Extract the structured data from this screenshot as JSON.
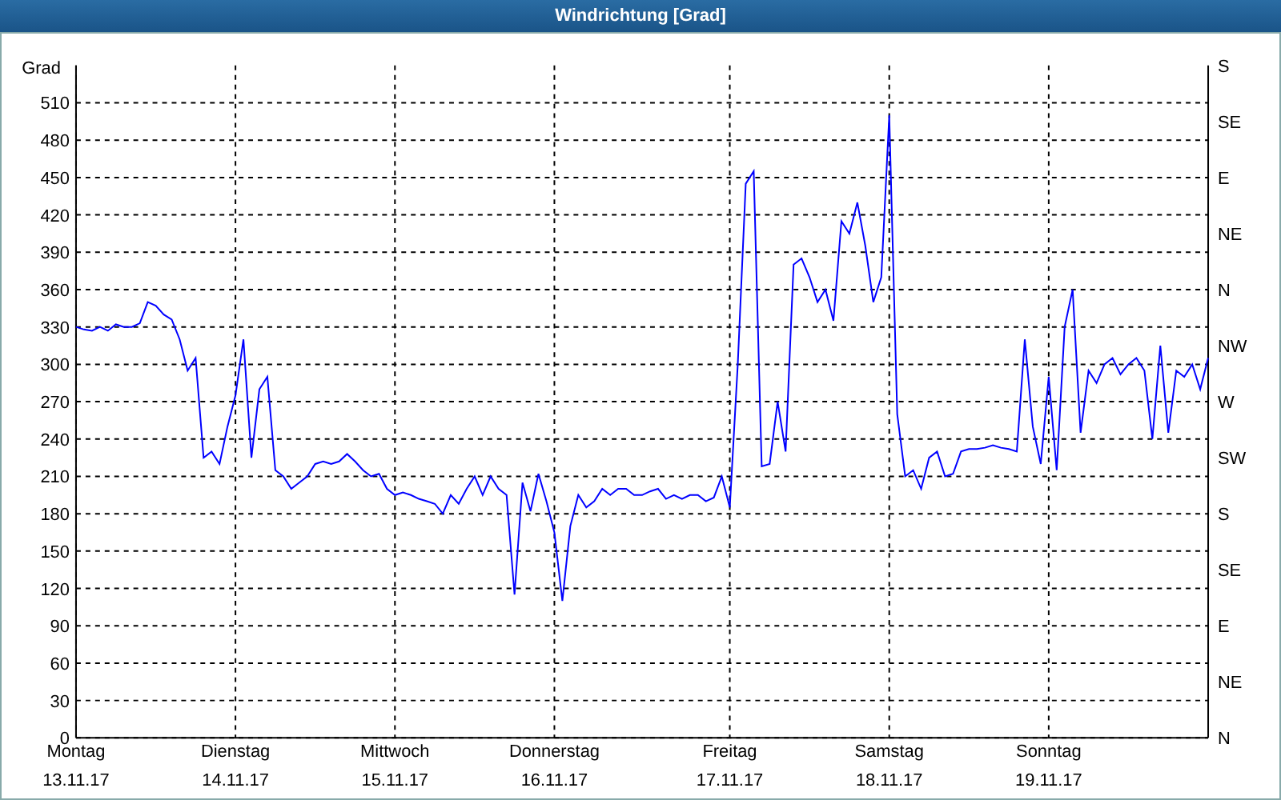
{
  "window": {
    "title": "Windrichtung [Grad]"
  },
  "chart": {
    "compass_labels": [
      "S",
      "SE",
      "E",
      "NE",
      "N",
      "NW",
      "W",
      "SW",
      "S",
      "SE",
      "E",
      "NE",
      "N"
    ],
    "dates": [
      "13.11.17",
      "14.11.17",
      "15.11.17",
      "16.11.17",
      "17.11.17",
      "18.11.17",
      "19.11.17"
    ],
    "chart_data": {
      "type": "line",
      "grid": true,
      "ylabel": "Grad",
      "ylim": [
        0,
        540
      ],
      "yticks": [
        0,
        30,
        60,
        90,
        120,
        150,
        180,
        210,
        240,
        270,
        300,
        330,
        360,
        390,
        420,
        450,
        480,
        510
      ],
      "categories": [
        "Montag",
        null,
        null,
        null,
        null,
        null,
        null,
        null,
        null,
        null,
        null,
        null,
        null,
        null,
        null,
        null,
        null,
        null,
        null,
        null,
        "Dienstag",
        null,
        null,
        null,
        null,
        null,
        null,
        null,
        null,
        null,
        null,
        null,
        null,
        null,
        null,
        null,
        null,
        null,
        null,
        null,
        "Mittwoch",
        null,
        null,
        null,
        null,
        null,
        null,
        null,
        null,
        null,
        null,
        null,
        null,
        null,
        null,
        null,
        null,
        null,
        null,
        null,
        "Donnerstag",
        null,
        null,
        null,
        null,
        null,
        null,
        null,
        null,
        null,
        null,
        null,
        null,
        null,
        null,
        null,
        null,
        null,
        null,
        null,
        null,
        null,
        "Freitag",
        null,
        null,
        null,
        null,
        null,
        null,
        null,
        null,
        null,
        null,
        null,
        null,
        null,
        null,
        null,
        null,
        null,
        null,
        null,
        "Samstag",
        null,
        null,
        null,
        null,
        null,
        null,
        null,
        null,
        null,
        null,
        null,
        null,
        null,
        null,
        null,
        null,
        null,
        null,
        null,
        "Sonntag",
        null,
        null,
        null,
        null,
        null,
        null,
        null,
        null,
        null,
        null,
        null,
        null,
        null,
        null,
        null,
        null,
        null,
        null,
        null,
        null
      ],
      "series": [
        {
          "color": "#0000ff",
          "values": [
            330,
            328,
            327,
            330,
            327,
            332,
            330,
            330,
            333,
            350,
            347,
            340,
            336,
            320,
            295,
            305,
            225,
            230,
            220,
            250,
            275,
            320,
            225,
            280,
            290,
            215,
            210,
            200,
            205,
            210,
            220,
            222,
            220,
            222,
            228,
            222,
            215,
            210,
            212,
            200,
            195,
            197,
            195,
            192,
            190,
            188,
            180,
            195,
            188,
            200,
            210,
            195,
            210,
            200,
            195,
            115,
            205,
            182,
            212,
            190,
            165,
            110,
            170,
            195,
            185,
            190,
            200,
            195,
            200,
            200,
            195,
            195,
            198,
            200,
            192,
            195,
            192,
            195,
            195,
            190,
            193,
            210,
            185,
            300,
            445,
            455,
            218,
            220,
            270,
            230,
            380,
            385,
            370,
            350,
            360,
            335,
            415,
            405,
            430,
            395,
            350,
            370,
            500,
            260,
            210,
            215,
            200,
            225,
            230,
            210,
            212,
            230,
            232,
            232,
            233,
            235,
            233,
            232,
            230,
            320,
            250,
            220,
            290,
            215,
            330,
            360,
            245,
            295,
            285,
            300,
            305,
            292,
            300,
            305,
            295,
            240,
            315,
            245,
            295,
            290,
            300,
            280,
            305
          ]
        }
      ]
    }
  }
}
